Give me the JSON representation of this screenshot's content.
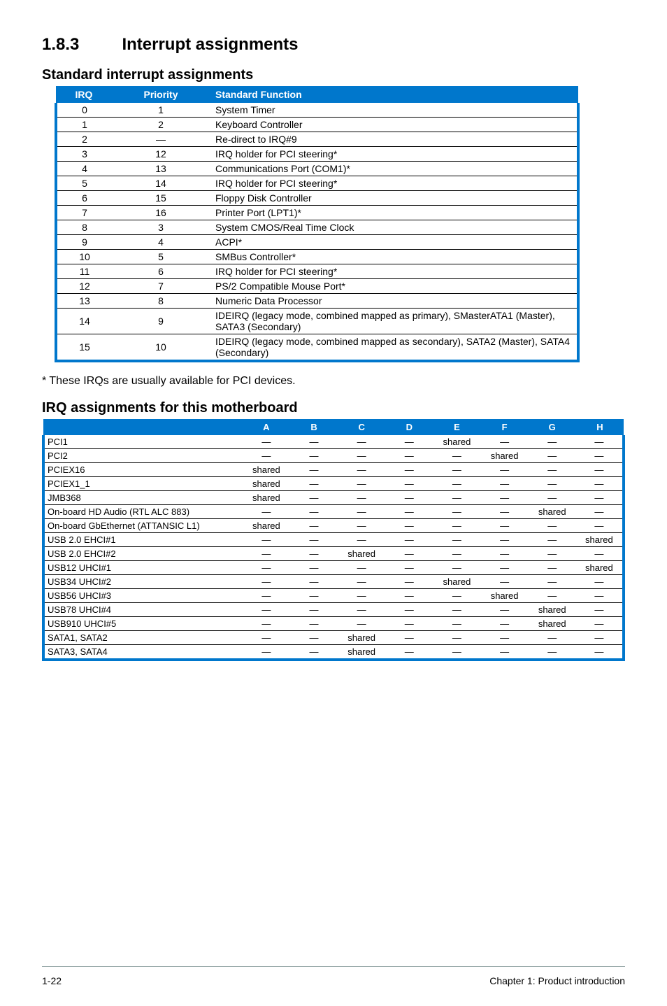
{
  "section": {
    "number": "1.8.3",
    "title": "Interrupt assignments"
  },
  "subheadings": {
    "standard": "Standard interrupt assignments",
    "note": "* These IRQs are usually available for PCI devices.",
    "irq": "IRQ assignments for this motherboard"
  },
  "std_table": {
    "headers": [
      "IRQ",
      "Priority",
      "Standard Function"
    ],
    "rows": [
      [
        "0",
        "1",
        "System Timer"
      ],
      [
        "1",
        "2",
        "Keyboard Controller"
      ],
      [
        "2",
        "—",
        "Re-direct to IRQ#9"
      ],
      [
        "3",
        "12",
        "IRQ holder for PCI steering*"
      ],
      [
        "4",
        "13",
        "Communications Port (COM1)*"
      ],
      [
        "5",
        "14",
        "IRQ holder for PCI steering*"
      ],
      [
        "6",
        "15",
        "Floppy Disk Controller"
      ],
      [
        "7",
        "16",
        "Printer Port (LPT1)*"
      ],
      [
        "8",
        "3",
        "System CMOS/Real Time Clock"
      ],
      [
        "9",
        "4",
        "ACPI*"
      ],
      [
        "10",
        "5",
        "SMBus Controller*"
      ],
      [
        "11",
        "6",
        "IRQ holder for PCI steering*"
      ],
      [
        "12",
        "7",
        "PS/2 Compatible Mouse Port*"
      ],
      [
        "13",
        "8",
        "Numeric Data Processor"
      ],
      [
        "14",
        "9",
        "IDEIRQ (legacy mode, combined mapped as primary), SMasterATA1 (Master), SATA3 (Secondary)"
      ],
      [
        "15",
        "10",
        "IDEIRQ (legacy mode, combined mapped as secondary), SATA2 (Master), SATA4 (Secondary)"
      ]
    ]
  },
  "irq_table": {
    "headers": [
      "",
      "A",
      "B",
      "C",
      "D",
      "E",
      "F",
      "G",
      "H"
    ],
    "rows": [
      [
        "PCI1",
        "—",
        "—",
        "—",
        "—",
        "shared",
        "—",
        "—",
        "—"
      ],
      [
        "PCI2",
        "—",
        "—",
        "—",
        "—",
        "—",
        "shared",
        "—",
        "—"
      ],
      [
        "PCIEX16",
        "shared",
        "—",
        "—",
        "—",
        "—",
        "—",
        "—",
        "—"
      ],
      [
        "PCIEX1_1",
        "shared",
        "—",
        "—",
        "—",
        "—",
        "—",
        "—",
        "—"
      ],
      [
        "JMB368",
        "shared",
        "—",
        "—",
        "—",
        "—",
        "—",
        "—",
        "—"
      ],
      [
        "On-board HD Audio (RTL ALC 883)",
        "—",
        "—",
        "—",
        "—",
        "—",
        "—",
        "shared",
        "—"
      ],
      [
        "On-board GbEthernet (ATTANSIC L1)",
        "shared",
        "—",
        "—",
        "—",
        "—",
        "—",
        "—",
        "—"
      ],
      [
        "USB 2.0 EHCI#1",
        "—",
        "—",
        "—",
        "—",
        "—",
        "—",
        "—",
        "shared"
      ],
      [
        "USB 2.0 EHCI#2",
        "—",
        "—",
        "shared",
        "—",
        "—",
        "—",
        "—",
        "—"
      ],
      [
        "USB12 UHCI#1",
        "—",
        "—",
        "—",
        "—",
        "—",
        "—",
        "—",
        "shared"
      ],
      [
        "USB34 UHCI#2",
        "—",
        "—",
        "—",
        "—",
        "shared",
        "—",
        "—",
        "—"
      ],
      [
        "USB56 UHCI#3",
        "—",
        "—",
        "—",
        "—",
        "—",
        "shared",
        "—",
        "—"
      ],
      [
        "USB78 UHCI#4",
        "—",
        "—",
        "—",
        "—",
        "—",
        "—",
        "shared",
        "—"
      ],
      [
        "USB910 UHCI#5",
        "—",
        "—",
        "—",
        "—",
        "—",
        "—",
        "shared",
        "—"
      ],
      [
        "SATA1, SATA2",
        "—",
        "—",
        "shared",
        "—",
        "—",
        "—",
        "—",
        "—"
      ],
      [
        "SATA3, SATA4",
        "—",
        "—",
        "shared",
        "—",
        "—",
        "—",
        "—",
        "—"
      ]
    ]
  },
  "footer": {
    "left": "1-22",
    "right": "Chapter 1: Product introduction"
  }
}
